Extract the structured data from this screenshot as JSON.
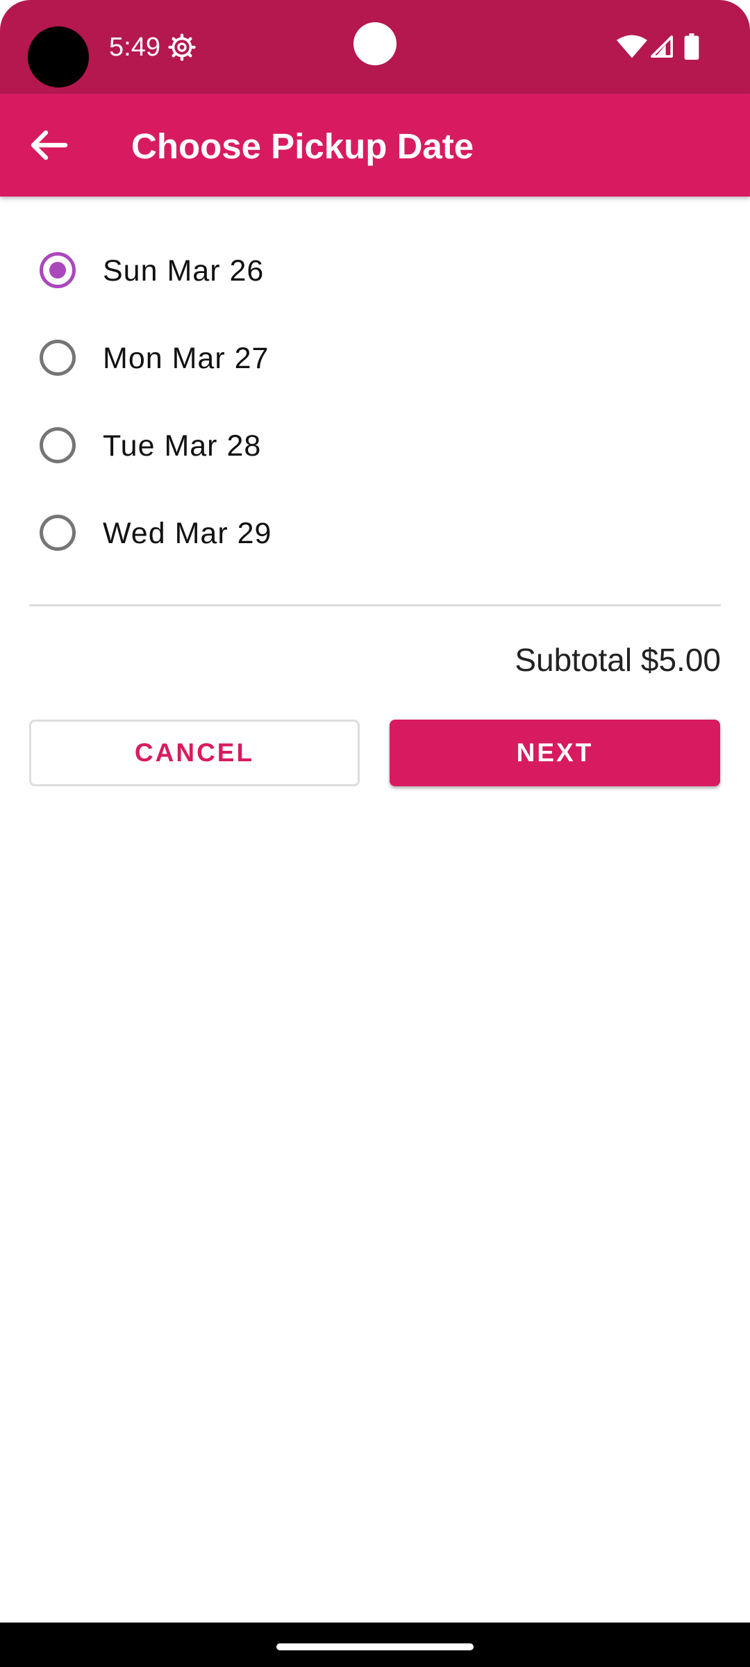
{
  "status_bar": {
    "time": "5:49",
    "colors": {
      "background": "#b5174f"
    },
    "icons": [
      "settings-icon",
      "wifi-icon",
      "signal-icon",
      "battery-icon"
    ]
  },
  "app_bar": {
    "title": "Choose Pickup Date",
    "back_icon": "arrow-left-icon",
    "background": "#d81b60"
  },
  "dates": {
    "selected_index": 0,
    "options": [
      {
        "label": "Sun Mar 26",
        "checked": true
      },
      {
        "label": "Mon Mar 27",
        "checked": false
      },
      {
        "label": "Tue Mar 28",
        "checked": false
      },
      {
        "label": "Wed Mar 29",
        "checked": false
      }
    ],
    "accent_color": "#ab47bc"
  },
  "summary": {
    "subtotal": "Subtotal $5.00"
  },
  "actions": {
    "cancel_label": "CANCEL",
    "next_label": "NEXT",
    "primary_color": "#d81b60"
  }
}
